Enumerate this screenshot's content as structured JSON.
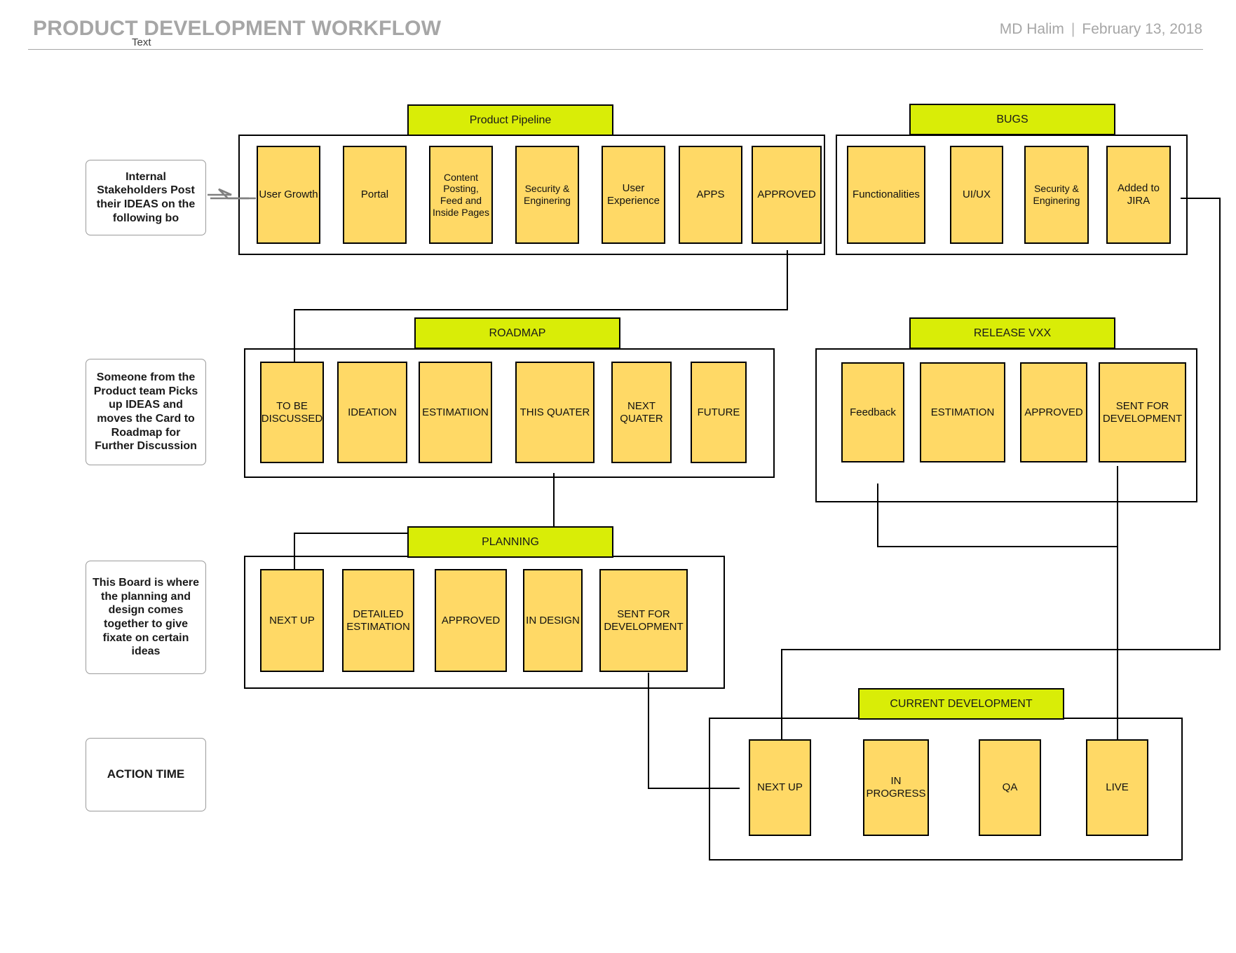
{
  "header": {
    "title": "PRODUCT DEVELOPMENT WORKFLOW",
    "subtitle": "Text",
    "author": "MD Halim",
    "separator": "|",
    "date": "February 13, 2018"
  },
  "notes": [
    {
      "id": "note-stakeholders",
      "text": "Internal Stakeholders Post their IDEAS on the following bo"
    },
    {
      "id": "note-product-team",
      "text": "Someone from the Product team Picks up IDEAS and moves the Card to Roadmap for Further Discussion"
    },
    {
      "id": "note-planning-board",
      "text": "This Board is where  the planning and design comes together to give fixate on certain ideas"
    },
    {
      "id": "note-action-time",
      "text": "ACTION TIME"
    }
  ],
  "boards": [
    {
      "id": "product-pipeline",
      "title": "Product Pipeline",
      "cards": [
        "User Growth",
        "Portal",
        "Content Posting, Feed and Inside Pages",
        "Security & Enginering",
        "User Experience",
        "APPS",
        "APPROVED"
      ]
    },
    {
      "id": "bugs",
      "title": "BUGS",
      "cards": [
        "Functionalities",
        "UI/UX",
        "Security & Enginering",
        "Added to JIRA"
      ]
    },
    {
      "id": "roadmap",
      "title": "ROADMAP",
      "cards": [
        "TO BE DISCUSSED",
        "IDEATION",
        "ESTIMATIION",
        "THIS QUATER",
        "NEXT QUATER",
        "FUTURE"
      ]
    },
    {
      "id": "release-vxx",
      "title": "RELEASE VXX",
      "cards": [
        "Feedback",
        "ESTIMATION",
        "APPROVED",
        "SENT FOR DEVELOPMENT"
      ]
    },
    {
      "id": "planning",
      "title": "PLANNING",
      "cards": [
        "NEXT UP",
        "DETAILED ESTIMATION",
        "APPROVED",
        "IN DESIGN",
        "SENT FOR DEVELOPMENT"
      ]
    },
    {
      "id": "current-development",
      "title": "CURRENT DEVELOPMENT",
      "cards": [
        "NEXT UP",
        "IN PROGRESS",
        "QA",
        "LIVE"
      ]
    }
  ],
  "colors": {
    "board_title_fill": "#d9ed07",
    "card_fill": "#ffd966",
    "outline": "#000000",
    "header_text": "#a6a6a6",
    "note_border": "#9b9b9b",
    "grey_arrow": "#808080"
  }
}
